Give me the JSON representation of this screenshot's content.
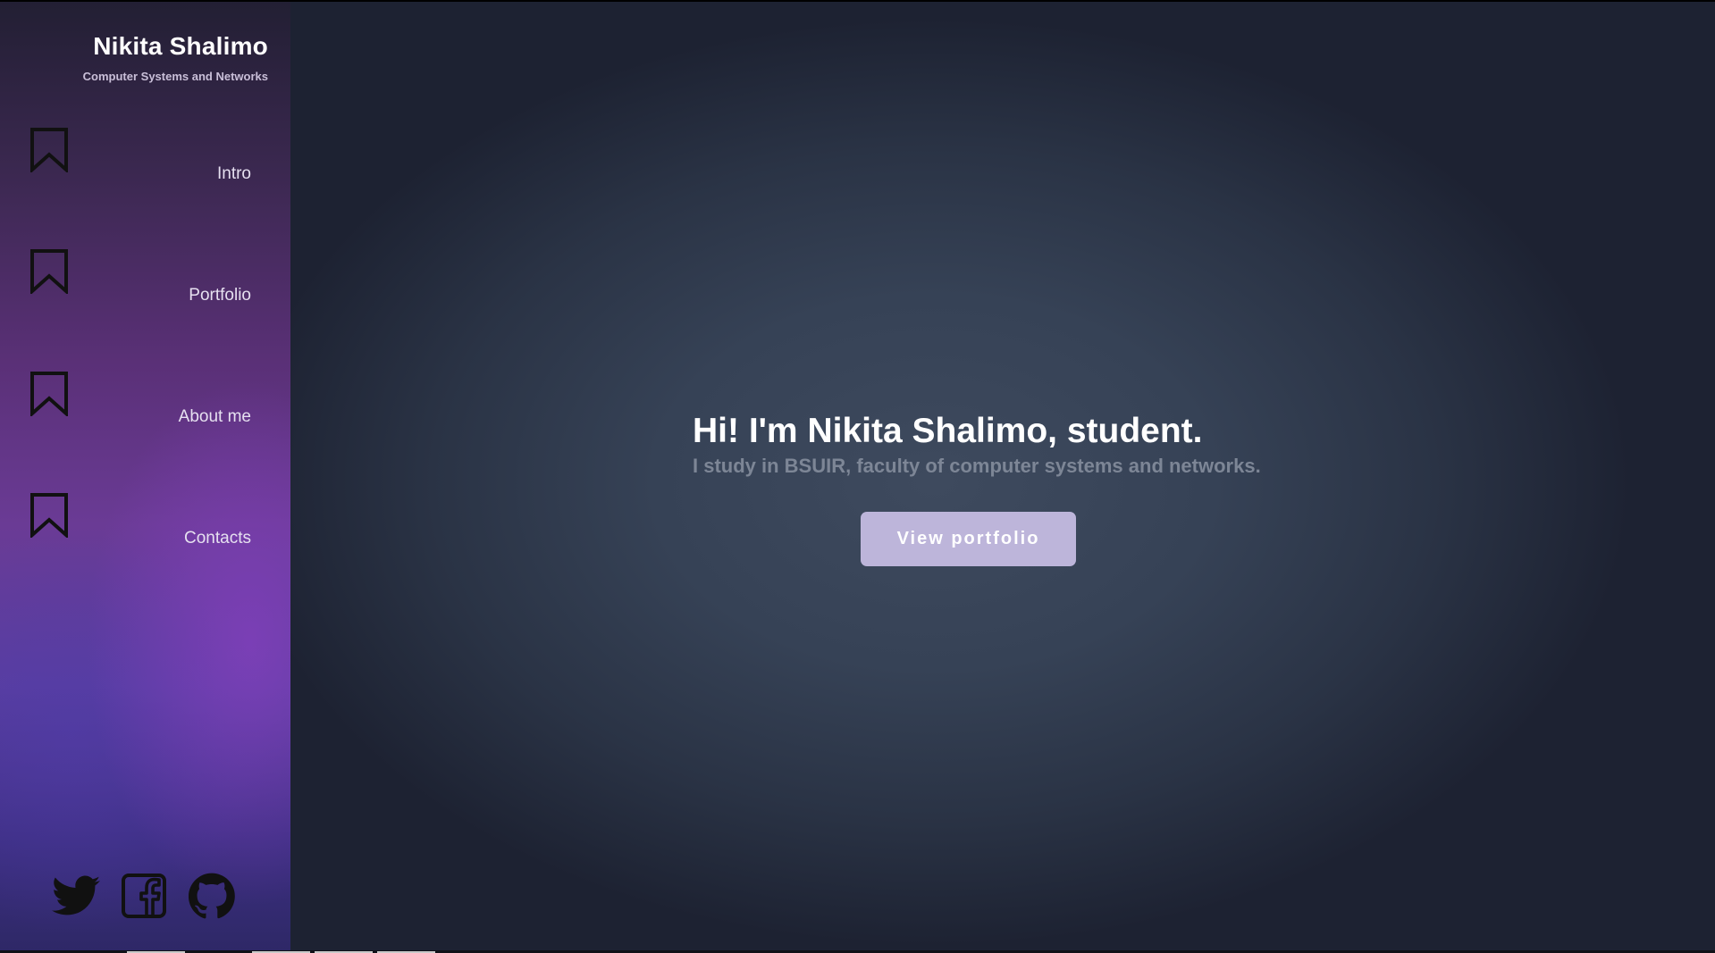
{
  "brand": {
    "name": "Nikita Shalimo",
    "subtitle": "Computer Systems and Networks"
  },
  "nav": {
    "items": [
      {
        "label": "Intro",
        "icon": "bookmark-icon"
      },
      {
        "label": "Portfolio",
        "icon": "bookmark-icon"
      },
      {
        "label": "About me",
        "icon": "bookmark-icon"
      },
      {
        "label": "Contacts",
        "icon": "bookmark-icon"
      }
    ]
  },
  "socials": [
    {
      "icon": "twitter-icon"
    },
    {
      "icon": "facebook-icon"
    },
    {
      "icon": "github-icon"
    }
  ],
  "hero": {
    "title": "Hi! I'm Nikita Shalimo, student.",
    "subtitle": "I study in BSUIR, faculty of computer systems and networks.",
    "cta_label": "View portfolio"
  },
  "colors": {
    "accent_button": "#bdb5da",
    "sidebar_purple": "#6a3b95",
    "main_background": "#364256",
    "muted_text": "#7d8696"
  }
}
